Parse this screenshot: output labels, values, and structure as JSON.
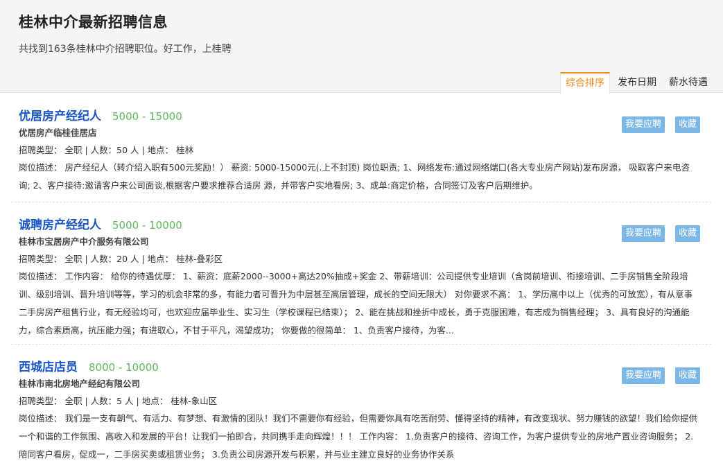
{
  "header": {
    "title": "桂林中介最新招聘信息",
    "subtitle": "共找到163条桂林中介招聘职位。好工作，上桂聘"
  },
  "sort_tabs": [
    {
      "label": "综合排序",
      "active": true
    },
    {
      "label": "发布日期",
      "active": false
    },
    {
      "label": "薪水待遇",
      "active": false
    }
  ],
  "colors": {
    "accent_orange": "#f08c1a",
    "title_blue": "#1a55c8",
    "salary_green": "#5cb85c",
    "button_blue": "#7ab6e6"
  },
  "jobs": [
    {
      "title": "优居房产经纪人",
      "salary": "5000 - 15000",
      "company": "优居房产临桂佳居店",
      "meta": "招聘类型： 全职 | 人数：50 人 | 地点： 桂林",
      "description": "岗位描述： 房产经纪人（转介绍入职有500元奖励！） 薪资: 5000-15000元(.上不封顶) 岗位职责; 1、网络发布:通过网络端口(各大专业房产网站)发布房源， 吸取客户来电咨询; 2、客户接待:邀请客户来公司面谈,根据客户要求推荐合适房 源，并带客户实地看房; 3、成单:商定价格，合同签订及客户后期维护。",
      "apply_label": "我要应聘",
      "save_label": "收藏"
    },
    {
      "title": "诚聘房产经纪人",
      "salary": "5000 - 10000",
      "company": "桂林市宝居房产中介服务有限公司",
      "meta": "招聘类型： 全职 | 人数：20 人 | 地点： 桂林-叠彩区",
      "description": "岗位描述： 工作内容： 给你的待遇优厚： 1、薪资：底薪2000--3000+高达20%抽成+奖金 2、带薪培训：公司提供专业培训（含岗前培训、衔接培训、二手房销售全阶段培训、级别培训、晋升培训等等，学习的机会非常的多，有能力者可晋升为中层甚至高层管理，成长的空间无限大） 对你要求不高： 1、学历高中以上（优秀的可放宽），有从意事二手房房产租售行业，有无经验均可，也欢迎应届毕业生、实习生（学校课程已结束）； 2、能在挑战和挫折中成长，勇于克服困难，有志成为销售经理； 3、具有良好的沟通能力，综合素质高，抗压能力强；有进取心，不甘于平凡，渴望成功； 你要做的很简单： 1、负责客户接待，为客...",
      "apply_label": "我要应聘",
      "save_label": "收藏"
    },
    {
      "title": "西城店店员",
      "salary": "8000 - 10000",
      "company": "桂林市南北房地产经纪有限公司",
      "meta": "招聘类型： 全职 | 人数：5 人 | 地点： 桂林-象山区",
      "description": "岗位描述： 我们是一支有朝气、有活力、有梦想、有激情的团队！我们不需要你有经验，但需要你具有吃苦耐劳、懂得坚持的精神，有改变现状、努力赚钱的欲望！我们给你提供一个和谐的工作氛围、高收入和发展的平台！让我们一拍即合，共同携手走向辉煌！！！ 工作内容： 1.负责客户的接待、咨询工作，为客户提供专业的房地产置业咨询服务； 2.陪同客户看房，促成一，二手房买卖或租赁业务； 3.负责公司房源开发与积累，并与业主建立良好的业务协作关系",
      "apply_label": "我要应聘",
      "save_label": "收藏"
    }
  ]
}
